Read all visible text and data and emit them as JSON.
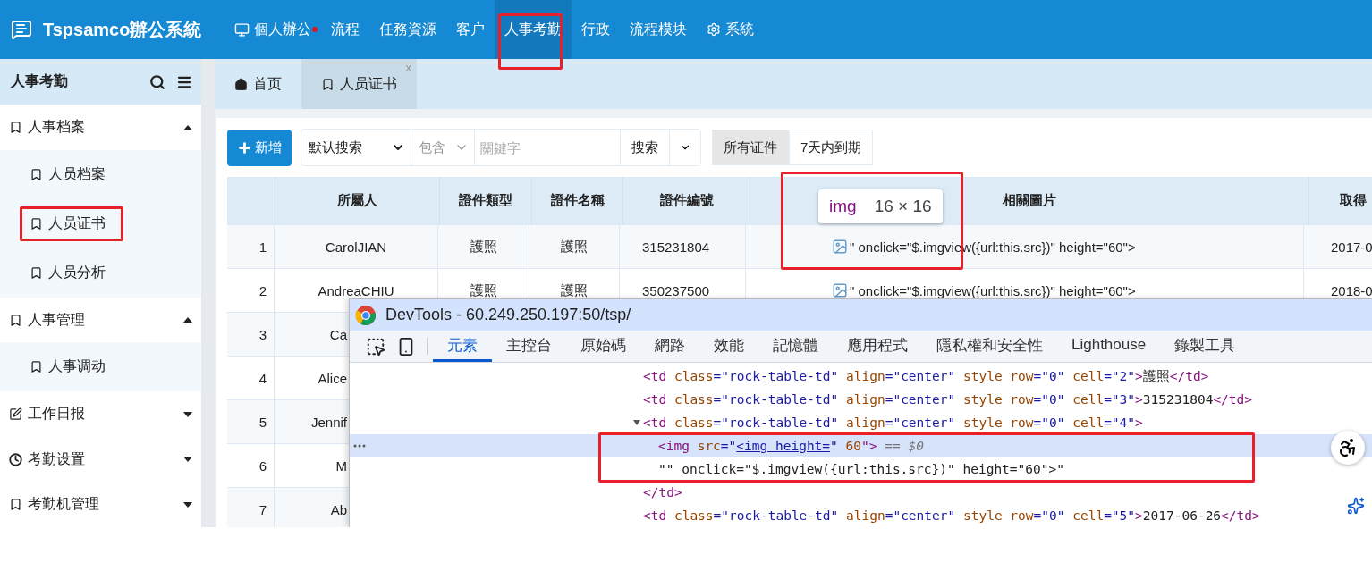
{
  "app": {
    "title": "Tspsamco辦公系統"
  },
  "nav": [
    {
      "label": "個人辦公",
      "kind": "desktop",
      "alert": true,
      "selected": false,
      "annotated": false
    },
    {
      "label": "流程",
      "kind": "plain",
      "alert": false,
      "selected": false,
      "annotated": false
    },
    {
      "label": "任務資源",
      "kind": "plain",
      "alert": false,
      "selected": false,
      "annotated": false
    },
    {
      "label": "客户",
      "kind": "plain",
      "alert": false,
      "selected": false,
      "annotated": false
    },
    {
      "label": "人事考勤",
      "kind": "plain",
      "alert": false,
      "selected": true,
      "annotated": true
    },
    {
      "label": "行政",
      "kind": "plain",
      "alert": false,
      "selected": false,
      "annotated": false
    },
    {
      "label": "流程模块",
      "kind": "plain",
      "alert": false,
      "selected": false,
      "annotated": false
    },
    {
      "label": "系統",
      "kind": "settings",
      "alert": false,
      "selected": false,
      "annotated": false
    }
  ],
  "sidebar": {
    "title": "人事考勤",
    "groups": [
      {
        "label": "人事档案",
        "kind": "bookmark",
        "expanded": true,
        "children": [
          {
            "label": "人员档案",
            "annotated": false
          },
          {
            "label": "人员证书",
            "annotated": true
          },
          {
            "label": "人员分析",
            "annotated": false
          }
        ]
      },
      {
        "label": "人事管理",
        "kind": "bookmark",
        "expanded": true,
        "children": [
          {
            "label": "人事调动",
            "annotated": false
          }
        ]
      },
      {
        "label": "工作日报",
        "kind": "edit",
        "expanded": false
      },
      {
        "label": "考勤设置",
        "kind": "clock",
        "expanded": false
      },
      {
        "label": "考勤机管理",
        "kind": "bookmark",
        "expanded": false
      }
    ]
  },
  "tabs": [
    {
      "label": "首页",
      "kind": "home",
      "selected": false
    },
    {
      "label": "人员证书",
      "kind": "bookmark",
      "selected": true,
      "close": "x"
    }
  ],
  "toolbar": {
    "add": "新增",
    "search_mode": "默认搜索",
    "match": "包含",
    "keyword": {
      "placeholder": "關鍵字"
    },
    "search": "搜索",
    "filters": [
      {
        "label": "所有证件",
        "selected": true
      },
      {
        "label": "7天内到期",
        "selected": false
      }
    ]
  },
  "table": {
    "columns": [
      "所屬人",
      "證件類型",
      "證件名稱",
      "證件編號",
      "相關圖片",
      "取得"
    ],
    "tooltip": {
      "tag": "img",
      "size": "16 × 16"
    },
    "rows": [
      {
        "kind": "full",
        "index": "1",
        "cells": [
          "CarolJIAN",
          "護照",
          "護照",
          "315231804",
          "\" onclick=\"$.imgview({url:this.src})\" height=\"60\">",
          "2017-0"
        ],
        "annotated": true
      },
      {
        "kind": "full",
        "index": "2",
        "cells": [
          "AndreaCHIU",
          "護照",
          "護照",
          "350237500",
          "\" onclick=\"$.imgview({url:this.src})\" height=\"60\">",
          "2018-0"
        ],
        "annotated": false
      },
      {
        "kind": "covered",
        "index": "3",
        "cells": [
          "Ca"
        ]
      },
      {
        "kind": "covered",
        "index": "4",
        "cells": [
          "Alice"
        ]
      },
      {
        "kind": "covered",
        "index": "5",
        "cells": [
          "Jennif"
        ]
      },
      {
        "kind": "covered",
        "index": "6",
        "cells": [
          "M"
        ]
      },
      {
        "kind": "covered",
        "index": "7",
        "cells": [
          "Ab"
        ]
      }
    ]
  },
  "devtools": {
    "title": "DevTools - 60.249.250.197:50/tsp/",
    "tabs": [
      {
        "label": "元素",
        "selected": true
      },
      {
        "label": "主控台",
        "selected": false
      },
      {
        "label": "原始碼",
        "selected": false
      },
      {
        "label": "網路",
        "selected": false
      },
      {
        "label": "效能",
        "selected": false
      },
      {
        "label": "記憶體",
        "selected": false
      },
      {
        "label": "應用程式",
        "selected": false
      },
      {
        "label": "隱私權和安全性",
        "selected": false
      },
      {
        "label": "Lighthouse",
        "selected": false
      },
      {
        "label": "錄製工具",
        "selected": false
      }
    ],
    "dom": [
      {
        "selected": false,
        "tokens": [
          {
            "kind": "tag",
            "text": "<td"
          },
          {
            "kind": "attr",
            "text": " class"
          },
          {
            "kind": "value",
            "text": "=\"rock-table-td\""
          },
          {
            "kind": "attr",
            "text": " align"
          },
          {
            "kind": "value",
            "text": "=\"center\""
          },
          {
            "kind": "attr",
            "text": " style row"
          },
          {
            "kind": "value",
            "text": "=\"0\""
          },
          {
            "kind": "attr",
            "text": " cell"
          },
          {
            "kind": "value",
            "text": "=\"2\""
          },
          {
            "kind": "tag",
            "text": ">"
          },
          {
            "kind": "text",
            "text": "護照"
          },
          {
            "kind": "tag",
            "text": "</td>"
          }
        ]
      },
      {
        "selected": false,
        "tokens": [
          {
            "kind": "tag",
            "text": "<td"
          },
          {
            "kind": "attr",
            "text": " class"
          },
          {
            "kind": "value",
            "text": "=\"rock-table-td\""
          },
          {
            "kind": "attr",
            "text": " align"
          },
          {
            "kind": "value",
            "text": "=\"center\""
          },
          {
            "kind": "attr",
            "text": " style row"
          },
          {
            "kind": "value",
            "text": "=\"0\""
          },
          {
            "kind": "attr",
            "text": " cell"
          },
          {
            "kind": "value",
            "text": "=\"3\""
          },
          {
            "kind": "tag",
            "text": ">"
          },
          {
            "kind": "text",
            "text": "315231804"
          },
          {
            "kind": "tag",
            "text": "</td>"
          }
        ]
      },
      {
        "selected": false,
        "expanded": true,
        "children_annotated": true,
        "tokens": [
          {
            "kind": "tag",
            "text": "<td"
          },
          {
            "kind": "attr",
            "text": " class"
          },
          {
            "kind": "value",
            "text": "=\"rock-table-td\""
          },
          {
            "kind": "attr",
            "text": " align"
          },
          {
            "kind": "value",
            "text": "=\"center\""
          },
          {
            "kind": "attr",
            "text": " style row"
          },
          {
            "kind": "value",
            "text": "=\"0\""
          },
          {
            "kind": "attr",
            "text": " cell"
          },
          {
            "kind": "value",
            "text": "=\"4\""
          },
          {
            "kind": "tag",
            "text": ">"
          }
        ],
        "closing": [
          {
            "kind": "tag",
            "text": "</td>"
          }
        ],
        "children": [
          {
            "selected": true,
            "tokens": [
              {
                "kind": "tag",
                "text": "<img"
              },
              {
                "kind": "attr",
                "text": " src"
              },
              {
                "kind": "value",
                "text": "=\""
              },
              {
                "kind": "link",
                "text": "<img height="
              },
              {
                "kind": "value",
                "text": "\""
              },
              {
                "kind": "attr",
                "text": " 60"
              },
              {
                "kind": "tag",
                "text": "\">"
              },
              {
                "kind": "comment",
                "text": " == $0"
              }
            ]
          },
          {
            "selected": false,
            "tokens": [
              {
                "kind": "text",
                "text": "\"\" onclick=\"$.imgview({url:this.src})\" height=\"60\">\""
              }
            ]
          }
        ]
      },
      {
        "selected": false,
        "tokens": [
          {
            "kind": "tag",
            "text": "<td"
          },
          {
            "kind": "attr",
            "text": " class"
          },
          {
            "kind": "value",
            "text": "=\"rock-table-td\""
          },
          {
            "kind": "attr",
            "text": " align"
          },
          {
            "kind": "value",
            "text": "=\"center\""
          },
          {
            "kind": "attr",
            "text": " style row"
          },
          {
            "kind": "value",
            "text": "=\"0\""
          },
          {
            "kind": "attr",
            "text": " cell"
          },
          {
            "kind": "value",
            "text": "=\"5\""
          },
          {
            "kind": "tag",
            "text": ">"
          },
          {
            "kind": "text",
            "text": "2017-06-26"
          },
          {
            "kind": "tag",
            "text": "</td>"
          }
        ]
      }
    ]
  }
}
